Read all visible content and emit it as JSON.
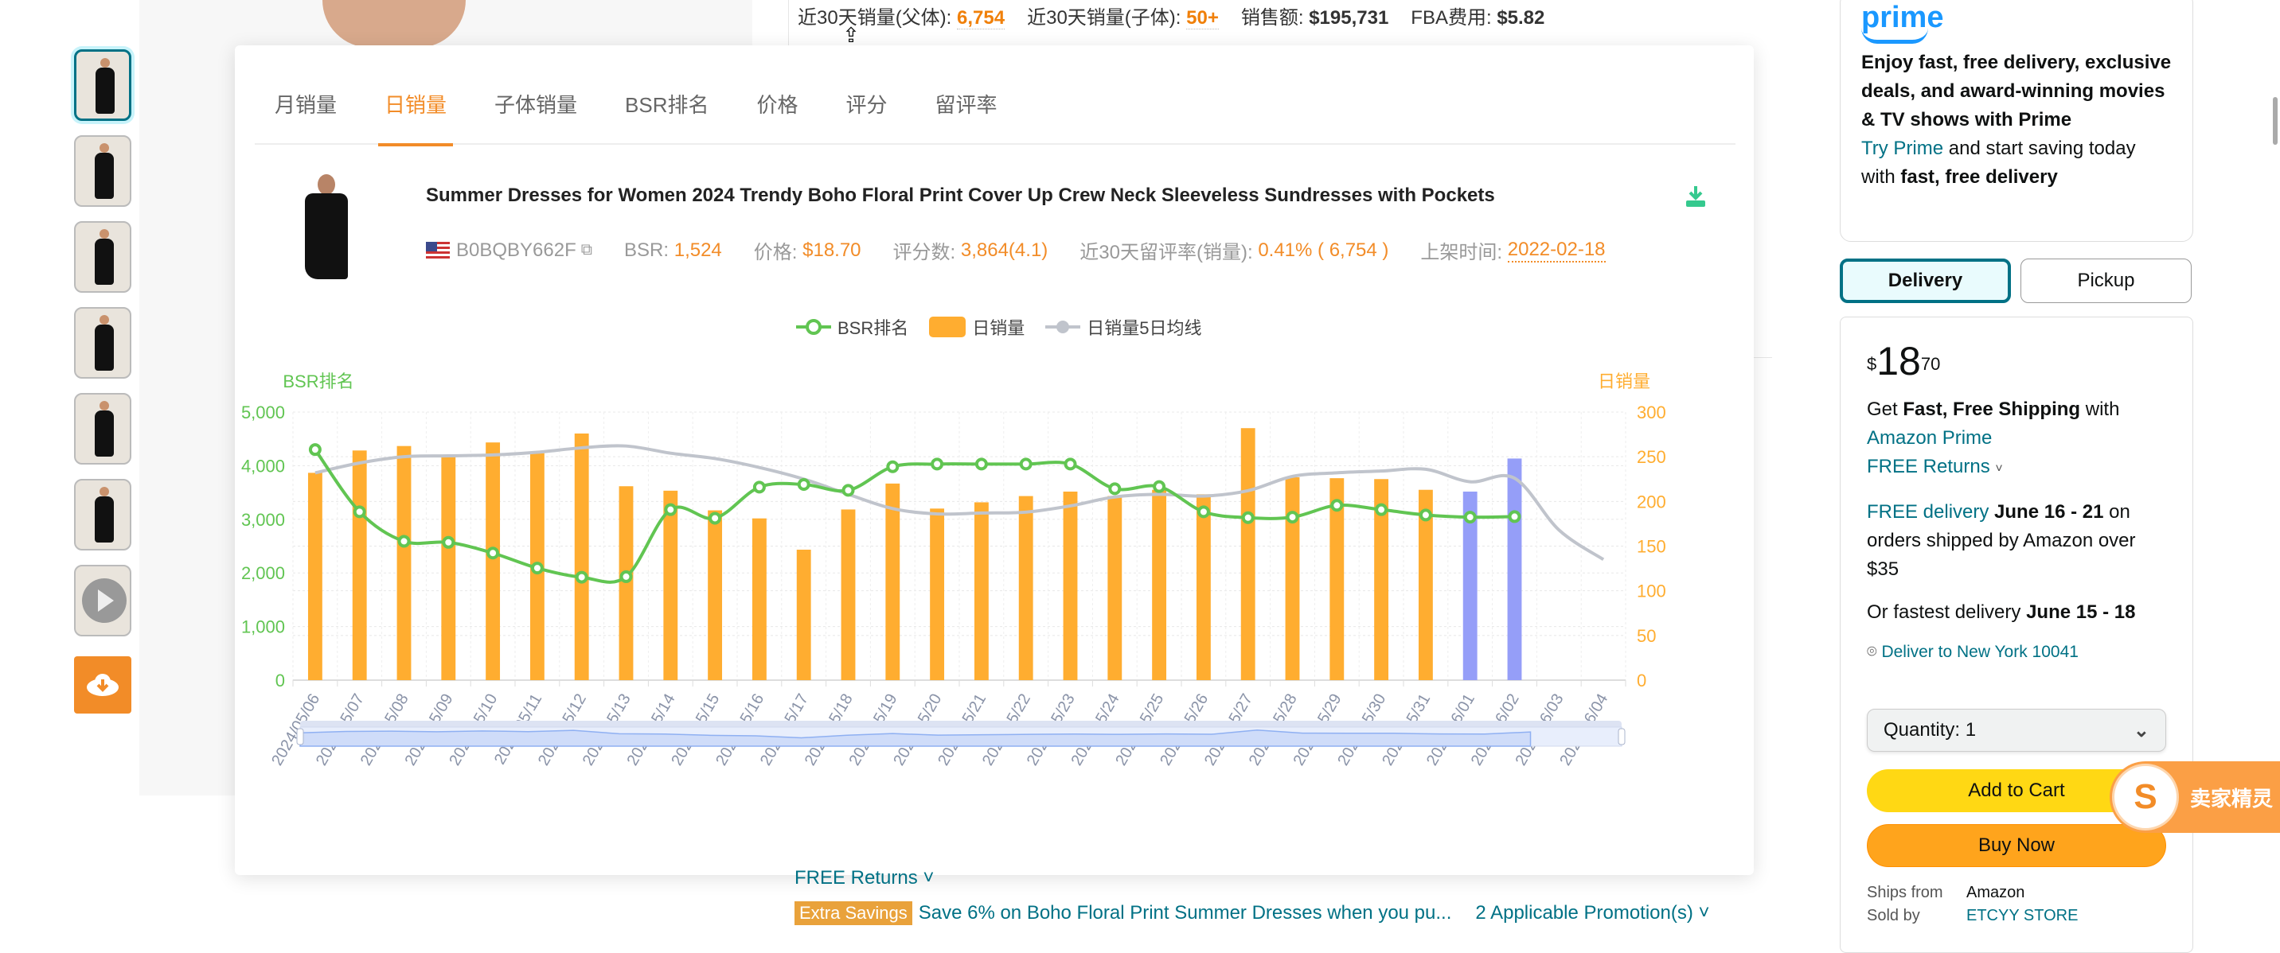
{
  "top_metrics": [
    {
      "label": "近30天销量(父体):",
      "value": "6,754",
      "style": "orange"
    },
    {
      "label": "近30天销量(子体):",
      "value": "50+",
      "style": "orange"
    },
    {
      "label": "销售额:",
      "value": "$195,731",
      "style": "dark"
    },
    {
      "label": "FBA费用:",
      "value": "$5.82",
      "style": "dark"
    }
  ],
  "panel": {
    "tabs": [
      "月销量",
      "日销量",
      "子体销量",
      "BSR排名",
      "价格",
      "评分",
      "留评率"
    ],
    "active_tab": "日销量",
    "product": {
      "title": "Summer Dresses for Women 2024 Trendy Boho Floral Print Cover Up Crew Neck Sleeveless Sundresses with Pockets",
      "asin": "B0BQBY662F",
      "bsr_label": "BSR:",
      "bsr": "1,524",
      "price_label": "价格:",
      "price": "$18.70",
      "reviews_label": "评分数:",
      "reviews": "3,864(4.1)",
      "review_rate_label": "近30天留评率(销量):",
      "review_rate": "0.41% ( 6,754 )",
      "listed_label": "上架时间:",
      "listed": "2022-02-18"
    },
    "icons": {
      "download": "download-icon",
      "flag": "us-flag-icon",
      "external": "external-link-icon"
    }
  },
  "chart_data": {
    "type": "bar",
    "title": "",
    "legend": [
      "BSR排名",
      "日销量",
      "日销量5日均线"
    ],
    "legend_position": "top-center",
    "y_left_label": "BSR排名",
    "y_right_label": "日销量",
    "y_left_ticks": [
      "0",
      "1,000",
      "2,000",
      "3,000",
      "4,000",
      "5,000"
    ],
    "y_right_ticks": [
      "0",
      "50",
      "100",
      "150",
      "200",
      "250",
      "300"
    ],
    "y_left_range": [
      0,
      5000
    ],
    "y_right_range": [
      0,
      300
    ],
    "grid": true,
    "categories": [
      "2024/05/06",
      "2024/05/07",
      "2024/05/08",
      "2024/05/09",
      "2024/05/10",
      "2024/05/11",
      "2024/05/12",
      "2024/05/13",
      "2024/05/14",
      "2024/05/15",
      "2024/05/16",
      "2024/05/17",
      "2024/05/18",
      "2024/05/19",
      "2024/05/20",
      "2024/05/21",
      "2024/05/22",
      "2024/05/23",
      "2024/05/24",
      "2024/05/25",
      "2024/05/26",
      "2024/05/27",
      "2024/05/28",
      "2024/05/29",
      "2024/05/30",
      "2024/05/31",
      "2024/06/01",
      "2024/06/02",
      "2024/06/03",
      "2024/06/04"
    ],
    "series": [
      {
        "name": "日销量",
        "type": "bar",
        "axis": "right",
        "color": "#ffad30",
        "values": [
          232,
          257,
          262,
          251,
          266,
          254,
          276,
          217,
          212,
          190,
          181,
          146,
          191,
          220,
          192,
          199,
          206,
          211,
          206,
          213,
          208,
          282,
          227,
          226,
          225,
          213,
          211,
          248,
          null,
          null
        ],
        "highlight_color": "#959ef8",
        "highlight_from_index": 26
      },
      {
        "name": "BSR排名",
        "type": "line",
        "axis": "left",
        "color": "#61c552",
        "values": [
          4300,
          3140,
          2590,
          2570,
          2370,
          2090,
          1920,
          1930,
          3180,
          3020,
          3600,
          3650,
          3540,
          3980,
          4030,
          4030,
          4030,
          4030,
          3570,
          3610,
          3140,
          3030,
          3040,
          3260,
          3180,
          3080,
          3040,
          3050,
          null,
          null
        ]
      },
      {
        "name": "日销量5日均线",
        "type": "line",
        "axis": "right",
        "color": "#c0c4cc",
        "values": [
          232,
          243,
          250,
          251,
          252,
          255,
          260,
          262,
          254,
          248,
          238,
          225,
          208,
          192,
          186,
          187,
          188,
          195,
          205,
          208,
          206,
          212,
          228,
          232,
          234,
          236,
          222,
          226,
          168,
          135
        ]
      }
    ],
    "datazoom_range": [
      0,
      100
    ]
  },
  "right": {
    "prime_logo": "prime",
    "prime_pitch": "Enjoy fast, free delivery, exclusive deals, and award-winning movies & TV shows with Prime",
    "try_prime": "Try Prime",
    "prime_after": " and start saving today with ",
    "prime_bold": "fast, free delivery",
    "delivery_tab": "Delivery",
    "pickup_tab": "Pickup",
    "price_symbol": "$",
    "price_whole": "18",
    "price_fraction": "70",
    "get_text": "Get ",
    "fast_free": "Fast, Free Shipping",
    "with_text": " with",
    "amazon_prime": "Amazon Prime",
    "free_returns": "FREE Returns",
    "free_delivery": "FREE delivery",
    "free_delivery_dates": " June 16 - 21",
    "free_delivery_rest": " on orders shipped by Amazon over $35",
    "fastest_text": "Or fastest delivery ",
    "fastest_dates": "June 15 - 18",
    "deliver_to": "Deliver to New York 10041",
    "quantity_label": "Quantity:",
    "quantity_value": "1",
    "add_to_cart": "Add to Cart",
    "buy_now": "Buy Now",
    "ships_from_label": "Ships from",
    "ships_from_value": "Amazon",
    "sold_by_label": "Sold by",
    "sold_by_value": "ETCYY STORE",
    "seller_badge": "卖家精灵"
  },
  "bottom": {
    "free_returns": "FREE Returns",
    "extra_savings": "Extra Savings",
    "promo_text": "Save 6% on Boho Floral Print Summer Dresses when you pu...",
    "promotions": "2 Applicable Promotion(s)"
  }
}
